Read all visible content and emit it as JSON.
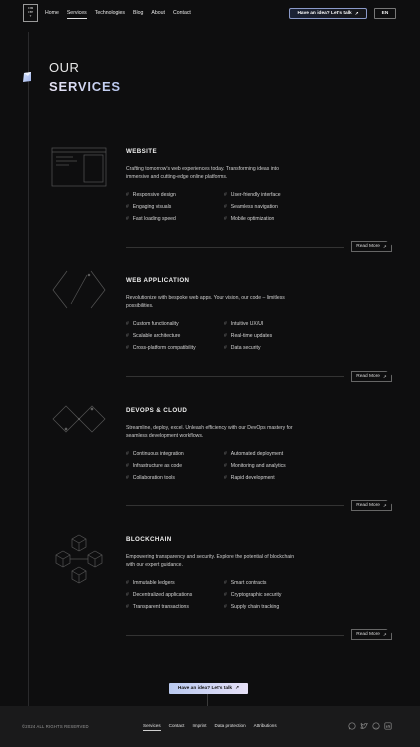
{
  "header": {
    "logo_text": "CON\nCEP\nT",
    "nav": [
      {
        "label": "Home",
        "active": false
      },
      {
        "label": "Services",
        "active": true
      },
      {
        "label": "Technologies",
        "active": false
      },
      {
        "label": "Blog",
        "active": false
      },
      {
        "label": "About",
        "active": false
      },
      {
        "label": "Contact",
        "active": false
      }
    ],
    "cta_label": "Have an idea? Let's talk",
    "cta_arrow": "↗",
    "lang": "EN"
  },
  "title": {
    "line1": "OUR",
    "line2": "SERVICES"
  },
  "sections": [
    {
      "title": "WEBSITE",
      "description": "Crafting tomorrow's web experiences today. Transforming ideas into immersive and cutting-edge online platforms.",
      "features_left": [
        "Responsive design",
        "Engaging visuals",
        "Fast loading speed"
      ],
      "features_right": [
        "User-friendly interface",
        "Seamless navigation",
        "Mobile optimization"
      ],
      "read_more": "Read More"
    },
    {
      "title": "WEB APPLICATION",
      "description": "Revolutionize with bespoke web apps. Your vision, our code – limitless possibilities.",
      "features_left": [
        "Custom functionality",
        "Scalable architecture",
        "Cross-platform compatibility"
      ],
      "features_right": [
        "Intuitive UX/UI",
        "Real-time updates",
        "Data security"
      ],
      "read_more": "Read More"
    },
    {
      "title": "DEVOPS & CLOUD",
      "description": "Streamline, deploy, excel. Unleash efficiency with our DevOps mastery for seamless development workflows.",
      "features_left": [
        "Continuous integration",
        "Infrastructure as code",
        "Collaboration tools"
      ],
      "features_right": [
        "Automated deployment",
        "Monitoring and analytics",
        "Rapid development"
      ],
      "read_more": "Read More"
    },
    {
      "title": "BLOCKCHAIN",
      "description": "Empowering transparency and security. Explore the potential of blockchain with our expert guidance.",
      "features_left": [
        "Immutable ledgers",
        "Decentralized applications",
        "Transparent transactions"
      ],
      "features_right": [
        "Smart contracts",
        "Cryptographic security",
        "Supply chain tracking"
      ],
      "read_more": "Read More"
    }
  ],
  "bottom_cta": "Have an idea? Let's talk",
  "footer": {
    "copyright": "©2024 ALL RIGHTS RESERVED",
    "nav": [
      {
        "label": "Services",
        "active": true
      },
      {
        "label": "Contact",
        "active": false
      },
      {
        "label": "Imprint",
        "active": false
      },
      {
        "label": "Data protection",
        "active": false
      },
      {
        "label": "Attributions",
        "active": false
      }
    ],
    "social_icons": [
      "whatsapp-icon",
      "twitter-icon",
      "github-icon",
      "linkedin-icon"
    ]
  },
  "colors": {
    "background": "#0e0e0f",
    "accent_gradient_start": "#b9c9ef",
    "accent_gradient_end": "#e6e0f7",
    "footer_bg": "#1a1a1b"
  }
}
